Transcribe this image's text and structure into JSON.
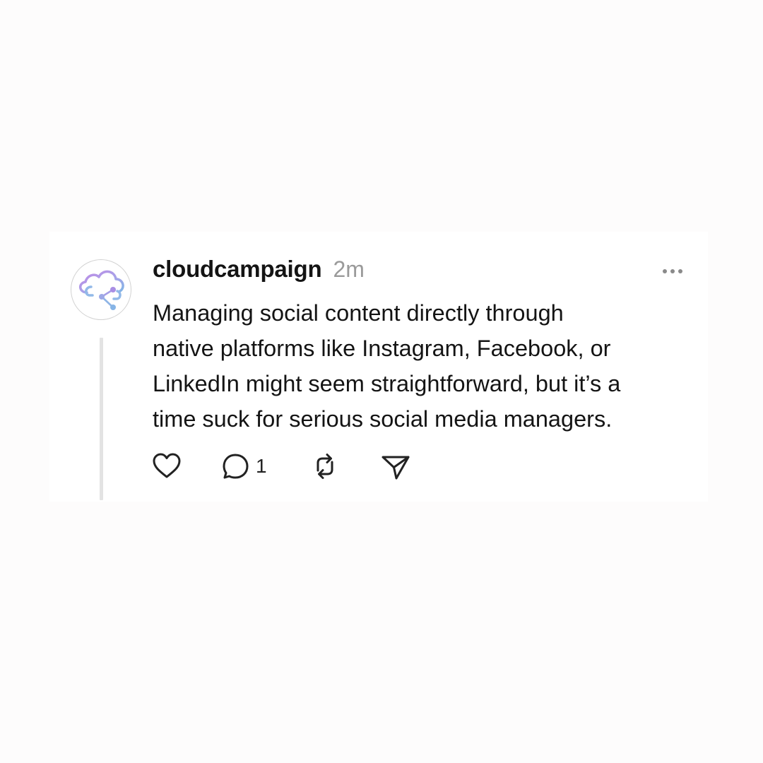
{
  "post": {
    "avatar_icon": "cloud-share-logo-icon",
    "username": "cloudcampaign",
    "timestamp": "2m",
    "more_icon": "more-horizontal-icon",
    "text_lines": [
      "Managing social content directly through",
      "native platforms like Instagram, Facebook, or",
      "LinkedIn might seem straightforward, but it’s a",
      "time suck for serious social media managers."
    ],
    "actions": {
      "like_icon": "heart-icon",
      "reply_icon": "comment-icon",
      "reply_count": "1",
      "repost_icon": "repost-icon",
      "share_icon": "send-icon"
    }
  },
  "colors": {
    "background": "#fdfcfc",
    "card": "#ffffff",
    "text": "#141414",
    "muted": "#9a9a9a",
    "thread_line": "#e3e3e3",
    "logo_purple": "#b48be0",
    "logo_blue": "#86b3e6"
  }
}
